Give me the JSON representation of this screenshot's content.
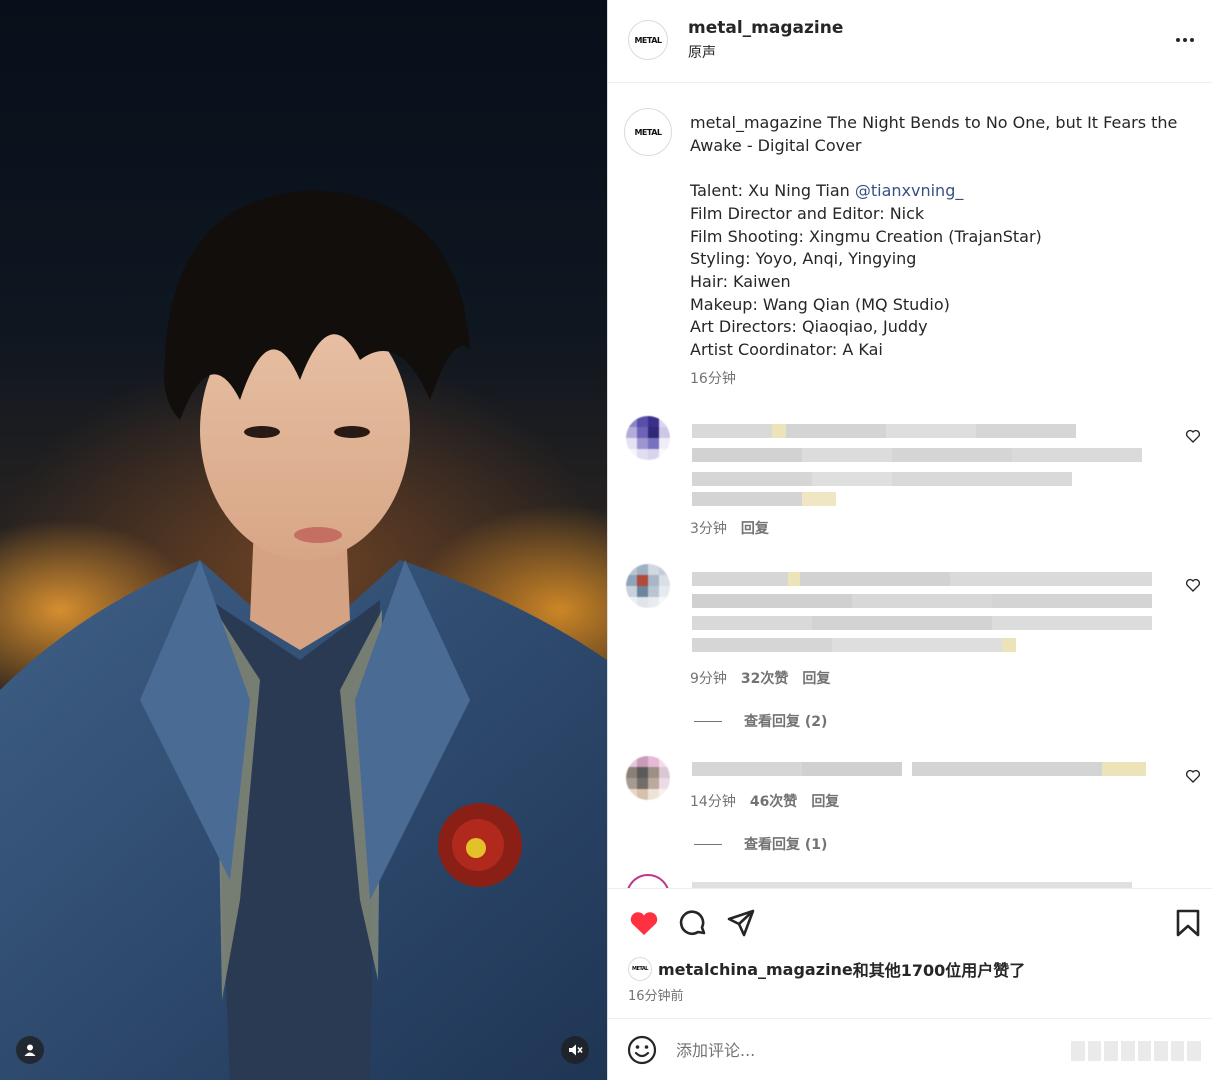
{
  "post": {
    "username": "metal_magazine",
    "audio_label": "原声",
    "logo_text": "METAL"
  },
  "caption": {
    "username": "metal_magazine",
    "title": "The Night Bends to No One, but It Fears the Awake - Digital Cover",
    "credits": [
      {
        "label": "Talent: Xu Ning Tian ",
        "mention": "@tianxvning_"
      },
      {
        "label": "Film Director and Editor: Nick"
      },
      {
        "label": "Film Shooting: Xingmu Creation (TrajanStar)"
      },
      {
        "label": "Styling: Yoyo, Anqi, Yingying"
      },
      {
        "label": "Hair: Kaiwen"
      },
      {
        "label": "Makeup: Wang Qian (MQ Studio)"
      },
      {
        "label": "Art Directors: Qiaoqiao, Juddy"
      },
      {
        "label": "Artist Coordinator: A Kai"
      }
    ],
    "time": "16分钟"
  },
  "comments": [
    {
      "time": "3分钟",
      "reply_label": "回复"
    },
    {
      "time": "9分钟",
      "likes": "32次赞",
      "reply_label": "回复",
      "view_replies": "查看回复 (2)"
    },
    {
      "time": "14分钟",
      "likes": "46次赞",
      "reply_label": "回复",
      "view_replies": "查看回复 (1)"
    }
  ],
  "likes_summary": {
    "liker": "metalchina_magazine",
    "text": "和其他1700位用户赞了",
    "time_ago": "16分钟前"
  },
  "add_comment": {
    "placeholder": "添加评论..."
  },
  "colors": {
    "heart": "#ff3040",
    "mention": "#385185",
    "muted_text": "#737373"
  },
  "icons": [
    "more-icon",
    "heart-icon",
    "comment-icon",
    "share-icon",
    "bookmark-icon",
    "emoji-icon",
    "user-tag-icon",
    "mute-icon"
  ]
}
